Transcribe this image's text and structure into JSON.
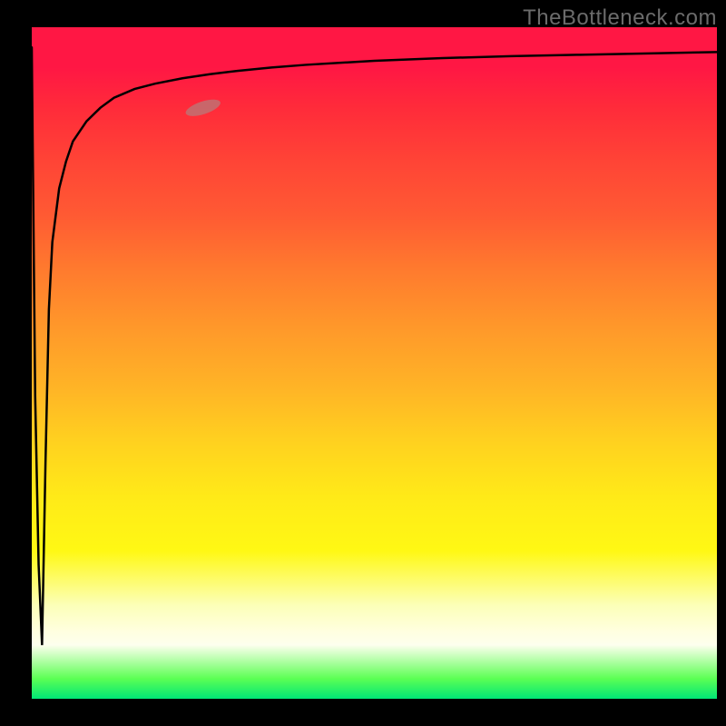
{
  "watermark": "TheBottleneck.com",
  "colors": {
    "background": "#000000",
    "top": "#ff1744",
    "mid1": "#ff7a2e",
    "mid2": "#ffea18",
    "pale": "#ffffe0",
    "bottom": "#00e676",
    "curve": "#000000",
    "marker": "#b77b7b"
  },
  "chart_data": {
    "type": "line",
    "title": "",
    "xlabel": "",
    "ylabel": "",
    "xlim": [
      0,
      100
    ],
    "ylim": [
      0,
      100
    ],
    "series": [
      {
        "name": "bottleneck-curve",
        "x": [
          0,
          0.5,
          1,
          1.5,
          2,
          2.5,
          3,
          4,
          5,
          6,
          8,
          10,
          12,
          15,
          18,
          22,
          26,
          30,
          35,
          40,
          50,
          60,
          70,
          80,
          90,
          100
        ],
        "y": [
          97,
          45,
          20,
          8,
          35,
          58,
          68,
          76,
          80,
          83,
          86,
          88,
          89.5,
          90.8,
          91.6,
          92.4,
          93,
          93.5,
          94,
          94.4,
          95,
          95.4,
          95.7,
          95.9,
          96.1,
          96.3
        ]
      }
    ],
    "annotations": [
      {
        "name": "highlight-pill",
        "x": 25,
        "y": 88,
        "angle_deg": -18,
        "rx": 20,
        "ry": 7,
        "color": "#b77b7b",
        "opacity": 0.75
      }
    ]
  }
}
